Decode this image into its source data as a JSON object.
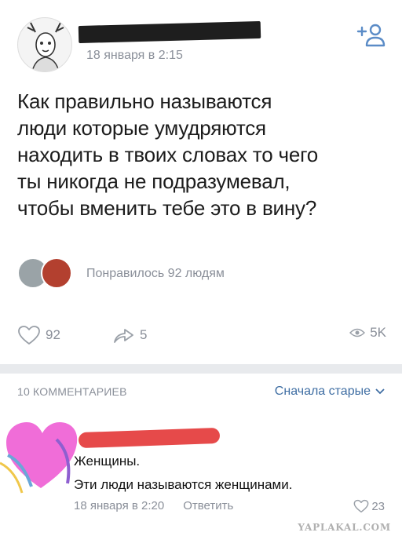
{
  "post": {
    "date": "18 января в 2:15",
    "text_lines": [
      "Как правильно называются",
      "люди которые умудряются",
      "находить в твоих словах то чего",
      "ты никогда не подразумевал,",
      "чтобы вменить тебе это в вину?"
    ],
    "liked_by": "Понравилось 92 людям",
    "likes": "92",
    "shares": "5",
    "views": "5K",
    "icons": {
      "add_friend": "add-friend-icon",
      "like": "heart-icon",
      "share": "share-icon",
      "views": "eye-icon"
    }
  },
  "comments_section": {
    "count_label": "10 КОММЕНТАРИЕВ",
    "sort_label": "Сначала старые"
  },
  "comment": {
    "lines": [
      "Женщины.",
      "Эти люди называются женщинами."
    ],
    "date": "18 января в 2:20",
    "reply_label": "Ответить",
    "likes": "23"
  },
  "watermark": "YAPLAKAL.COM",
  "colors": {
    "accent": "#3f6ea3",
    "muted": "#8a8f99",
    "divider": "#e8eaed",
    "redaction_dark": "#1e1e1e",
    "redaction_red": "#e64a4a"
  }
}
